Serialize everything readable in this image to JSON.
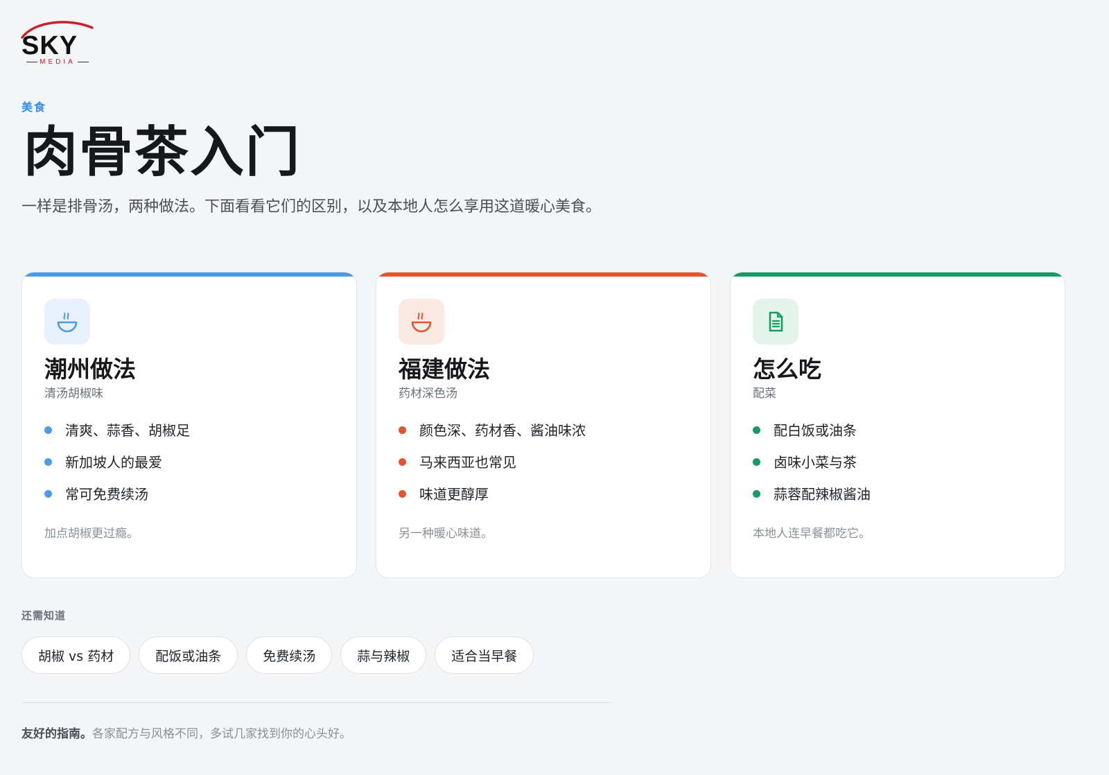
{
  "brand": {
    "logo_text": "SKY",
    "logo_subtext": "MEDIA",
    "logo_colors": {
      "arc": "#c8202a",
      "text": "#111111"
    }
  },
  "header": {
    "eyebrow": "美食",
    "title": "肉骨茶入门",
    "lead": "一样是排骨汤，两种做法。下面看看它们的区别，以及本地人怎么享用这道暖心美食。"
  },
  "cards": [
    {
      "accent": "#4b9be6",
      "tile_bg": "#e7f0fc",
      "icon": "soup-bowl-icon",
      "title": "潮州做法",
      "subtitle": "清汤胡椒味",
      "items": [
        "清爽、蒜香、胡椒足",
        "新加坡人的最爱",
        "常可免费续汤"
      ],
      "note": "加点胡椒更过瘾。"
    },
    {
      "accent": "#e4542f",
      "tile_bg": "#fce9e3",
      "icon": "soup-bowl-icon",
      "title": "福建做法",
      "subtitle": "药材深色汤",
      "items": [
        "颜色深、药材香、酱油味浓",
        "马来西亚也常见",
        "味道更醇厚"
      ],
      "note": "另一种暖心味道。"
    },
    {
      "accent": "#169b62",
      "tile_bg": "#e3f4ec",
      "icon": "document-icon",
      "title": "怎么吃",
      "subtitle": "配菜",
      "items": [
        "配白饭或油条",
        "卤味小菜与茶",
        "蒜蓉配辣椒酱油"
      ],
      "note": "本地人连早餐都吃它。"
    }
  ],
  "more": {
    "label": "还需知道",
    "chips": [
      "胡椒 vs 药材",
      "配饭或油条",
      "免费续汤",
      "蒜与辣椒",
      "适合当早餐"
    ]
  },
  "footer": {
    "strong": "友好的指南。",
    "text": "各家配方与风格不同，多试几家找到你的心头好。"
  }
}
